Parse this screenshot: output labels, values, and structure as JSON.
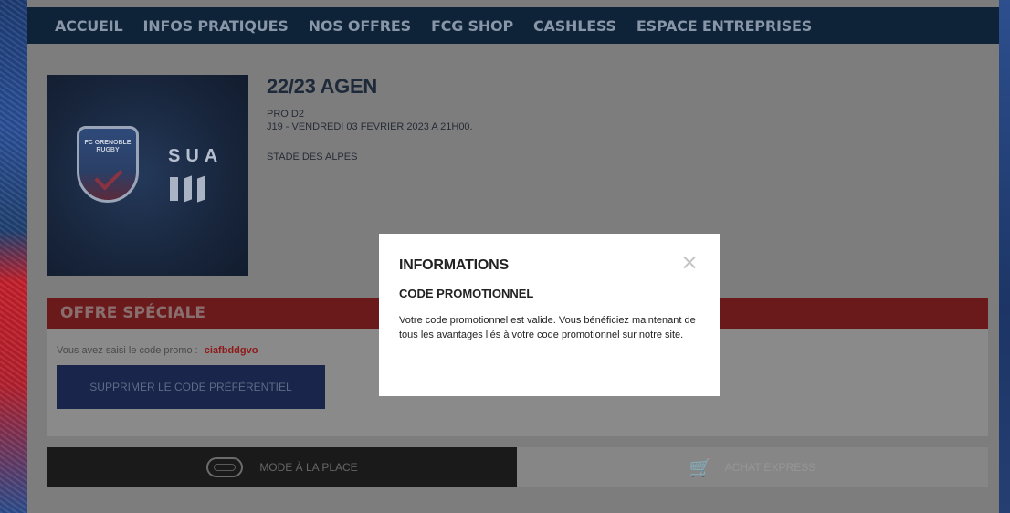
{
  "nav": {
    "items": [
      "ACCUEIL",
      "INFOS PRATIQUES",
      "NOS OFFRES",
      "FCG SHOP",
      "CASHLESS",
      "ESPACE ENTREPRISES"
    ]
  },
  "poster": {
    "left_logo_text": "FC GRENOBLE RUGBY",
    "right_logo_text": "SUA"
  },
  "match": {
    "title": "22/23 AGEN",
    "competition": "PRO D2",
    "date": "J19 - VENDREDI 03 FEVRIER 2023 A 21H00.",
    "venue": "STADE DES ALPES"
  },
  "offer": {
    "header": "OFFRE SPÉCIALE",
    "promo_label": "Vous avez saisi le code promo :",
    "promo_code": "ciafbddgvo",
    "remove_button": "SUPPRIMER LE CODE PRÉFÉRENTIEL"
  },
  "tabs": {
    "place": "MODE À LA PLACE",
    "express": "ACHAT EXPRESS"
  },
  "modal": {
    "title": "INFORMATIONS",
    "close": "×",
    "subtitle": "CODE PROMOTIONNEL",
    "text": "Votre code promotionnel est valide. Vous bénéficiez maintenant de tous les avantages liés à votre code promotionnel sur notre site."
  },
  "colors": {
    "nav_bg": "#0e2238",
    "offer_header_bg": "#6a1a1a",
    "promo_code": "#8e1a1a",
    "remove_button_bg": "#19254a"
  }
}
